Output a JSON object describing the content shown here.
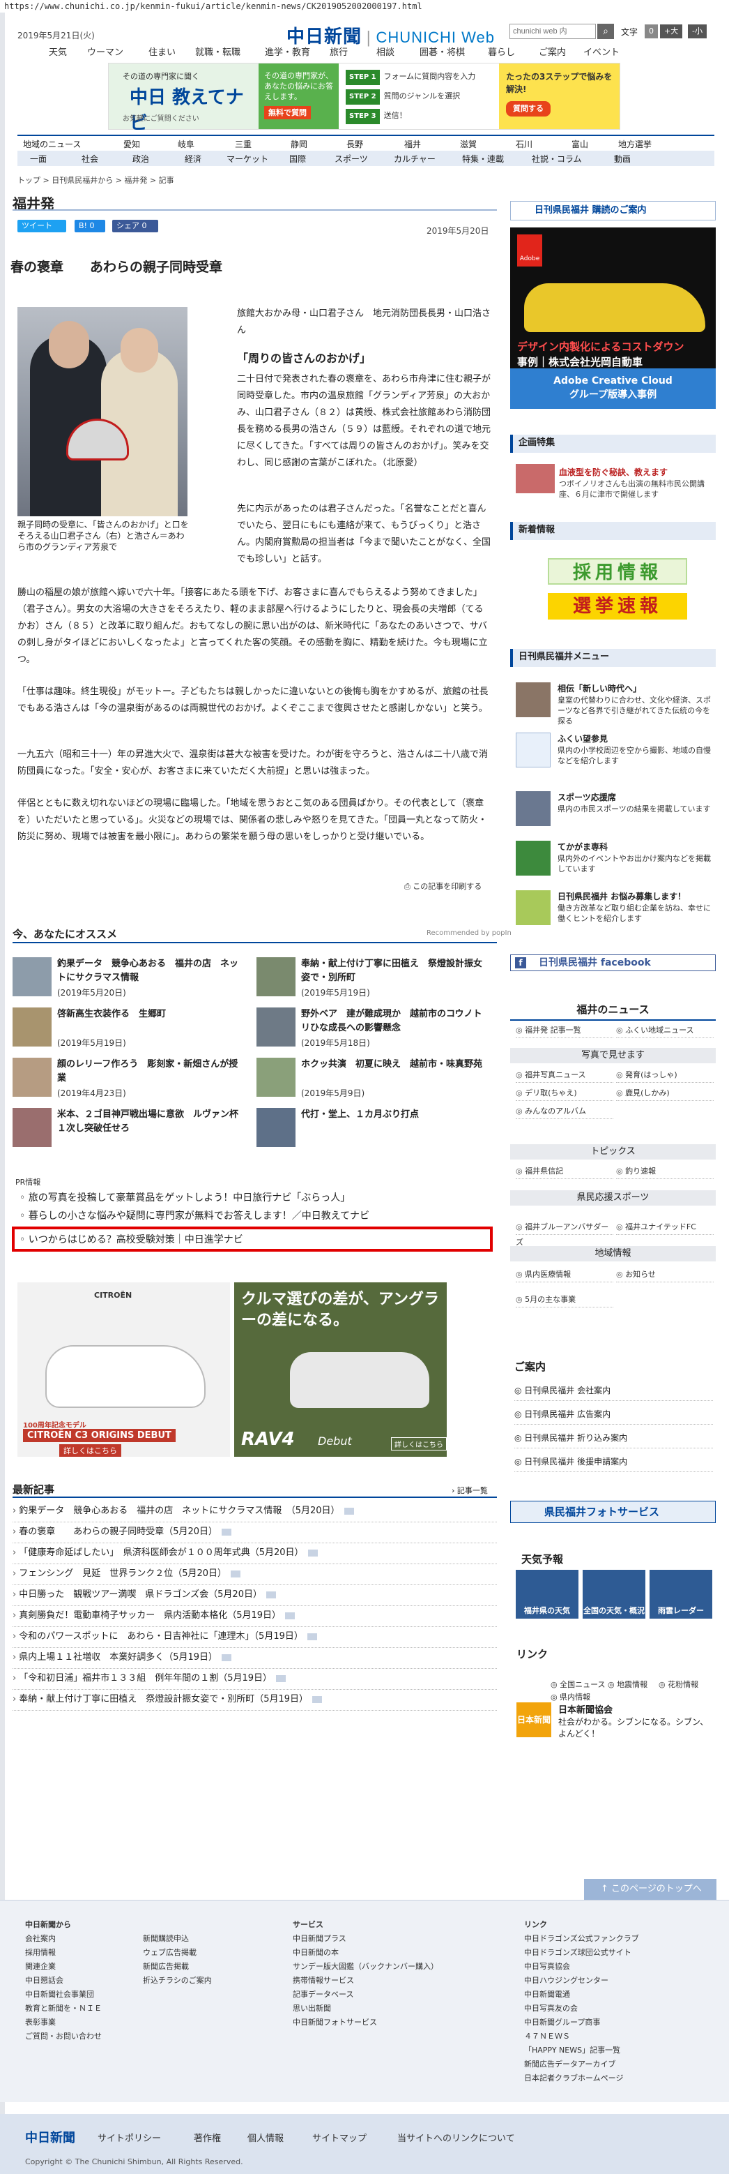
{
  "url": "https://www.chunichi.co.jp/kenmin-fukui/article/kenmin-news/CK2019052002000197.html",
  "header": {
    "date": "2019年5月21日(火)",
    "logo_jp": "中日新聞",
    "logo_en": "CHUNICHI Web",
    "search_placeholder": "chunichi web 内",
    "search_icon": "search-icon",
    "fontsize_label": "文字",
    "fontsize_reset": "0",
    "fontsize_up": "+大",
    "fontsize_down": "-小"
  },
  "topnav": [
    "天気",
    "ウーマン",
    "住まい",
    "就職・転職",
    "進学・教育",
    "旅行",
    "相談",
    "囲碁・将棋",
    "暮らし",
    "ご案内",
    "イベント"
  ],
  "banner": {
    "left_top": "その道の専門家に聞く",
    "left_title": "中日 教えてナビ",
    "left_note": "お気軽にご質問ください",
    "mid_text": "その道の専門家が、あなたの悩みにお答えします。",
    "mid_pill": "無料で質問",
    "steps": [
      {
        "step": "STEP 1",
        "text": "フォームに質問内容を入力"
      },
      {
        "step": "STEP 2",
        "text": "質問のジャンルを選択"
      },
      {
        "step": "STEP 3",
        "text": "送信！"
      }
    ],
    "right_title": "たったの3ステップで悩みを解決!",
    "right_btn": "質問する"
  },
  "regnav": [
    "地域のニュース",
    "愛知",
    "岐阜",
    "三重",
    "静岡",
    "長野",
    "福井",
    "滋賀",
    "石川",
    "富山",
    "地方選挙"
  ],
  "catnav": [
    "一面",
    "社会",
    "政治",
    "経済",
    "マーケット",
    "国際",
    "スポーツ",
    "カルチャー",
    "特集・連載",
    "社説・コラム",
    "動画"
  ],
  "breadcrumb": "トップ > 日刊県民福井から > 福井発 > 記事",
  "page_title": "福井発",
  "share": {
    "tweet": "ツイート",
    "b": "B! 0",
    "fb": "シェア 0"
  },
  "pub_date": "2019年5月20日",
  "article": {
    "headline": "春の褒章　　あわらの親子同時受章",
    "byline": "旅館大おかみ母・山口君子さん　地元消防団長長男・山口浩さん",
    "photo_caption": "親子同時の受章に、「皆さんのおかげ」と口をそろえる山口君子さん（右）と浩さん＝あわら市のグランディア芳泉で",
    "quote": "「周りの皆さんのおかげ」",
    "paragraphs": [
      "二十日付で発表された春の褒章を、あわら市舟津に住む親子が同時受章した。市内の温泉旅館「グランディア芳泉」の大おかみ、山口君子さん（８２）は黄綬、株式会社旅館あわら消防団長を務める長男の浩さん（５９）は藍綬。それぞれの道で地元に尽くしてきた。「すべては周りの皆さんのおかげ」。笑みを交わし、同じ感謝の言葉がこぼれた。（北原愛）",
      "先に内示があったのは君子さんだった。「名誉なことだと喜んでいたら、翌日にもにも連絡が来て、もうびっくり」と浩さん。内閣府賞勲局の担当者は「今まで聞いたことがなく、全国でも珍しい」と話す。",
      "勝山の稲屋の娘が旅館へ嫁いで六十年。「接客にあたる頭を下げ、お客さまに喜んでもらえるよう努めてきました」（君子さん）。男女の大浴場の大きさをそろえたり、軽のまま部屋へ行けるようにしたりと、現会長の夫増郎（てるかお）さん（８５）と改革に取り組んだ。おもてなしの腕に思い出がのは、新米時代に「あなたのあいさつで、サバの刺し身がタイほどにおいしくなったよ」と言ってくれた客の笑顔。その感動を胸に、精勤を続けた。今も現場に立つ。",
      "「仕事は趣味。終生現役」がモットー。子どもたちは親しかったに違いないとの後悔も胸をかすめるが、旅館の社長でもある浩さんは「今の温泉街があるのは両親世代のおかげ。よくぞここまで復興させたと感謝しかない」と笑う。",
      "一九五六（昭和三十一）年の昇進大火で、温泉街は甚大な被害を受けた。わが街を守ろうと、浩さんは二十八歳で消防団員になった。「安全・安心が、お客さまに来ていただく大前提」と思いは強まった。",
      "伴侶とともに数え切れないほどの現場に臨場した。「地域を思うおとこ気のある団員ばかり。その代表として（褒章を）いただいたと思っている」。火災などの現場では、関係者の悲しみや怒りを見てきた。「団員一丸となって防火・防災に努め、現場では被害を最小限に」。あわらの繁栄を願う母の思いをしっかりと受け継いでいる。"
    ],
    "print_link": "この記事を印刷する"
  },
  "recommend": {
    "title": "今、あなたにオススメ",
    "powered": "Recommended by popIn",
    "items": [
      {
        "title": "釣果データ　競争心あおる　福井の店　ネットにサクラマス情報",
        "date": "(2019年5月20日)"
      },
      {
        "title": "奉納・献上付け丁寧に田植え　祭燈設計振女姿で・別所町",
        "date": "(2019年5月19日)"
      },
      {
        "title": "啓新高生衣装作る　生郷町",
        "date": "(2019年5月19日)"
      },
      {
        "title": "野外ベア　建が難成現か　越前市のコウノトリひな成長への影響懸念",
        "date": "(2019年5月18日)"
      },
      {
        "title": "顔のレリーフ作ろう　彫刻家・新畑さんが授業",
        "date": "(2019年4月23日)"
      },
      {
        "title": "ホクッ共演　初夏に映え　越前市・味真野苑",
        "date": "(2019年5月9日)"
      },
      {
        "title": "米本、２ゴ目神戸戦出場に意欲　ルヴァン杯１次し突破任せろ",
        "date": ""
      },
      {
        "title": "代打・堂上、１カ月ぶり打点",
        "date": ""
      }
    ]
  },
  "pr": {
    "label": "PR情報",
    "links": [
      "旅の写真を投稿して豪華賞品をゲットしよう！中日旅行ナビ「ぶらっ人」",
      "暮らしの小さな悩みや疑問に専門家が無料でお答えします！／中日教えてナビ",
      "いつからはじめる？高校受験対策｜中日進学ナビ"
    ]
  },
  "ads": {
    "citroen_brand": "CITROËN",
    "citroen_l1": "100周年記念モデル",
    "citroen_l2": "CITROËN C3 ORIGINS DEBUT",
    "citroen_l3": "詳しくはこちら",
    "toyota_h": "クルマ選びの差が、アングラーの差になる。",
    "toyota_rav": "RAV4",
    "toyota_debut": "Debut",
    "toyota_det": "詳しくはこちら"
  },
  "latest": {
    "title": "最新記事",
    "all": "記事一覧",
    "items": [
      "釣果データ　競争心あおる　福井の店　ネットにサクラマス情報　（5月20日）",
      "春の褒章　　あわらの親子同時受章（5月20日）",
      "「健康寿命延ばしたい」　県済科医師会が１００周年式典（5月20日）",
      "フェンシング　見延　世界ランク２位（5月20日）",
      "中日勝った　観戦ツアー満喫　県ドラゴンズ会（5月20日）",
      "真剣勝負だ！電動車椅子サッカー　県内活動本格化（5月19日）",
      "令和のパワースポットに　あわら・日吉神社に「連理木」（5月19日）",
      "県内上場１１社増収　本業好調多く（5月19日）",
      "「令和初日浦」福井市１３３組　例年年間の１割（5月19日）",
      "奉納・献上付け丁寧に田植え　祭燈設計振女姿で・別所町（5月19日）"
    ]
  },
  "sidebar": {
    "koudoku": "日刊県民福井 購読のご案内",
    "adobe_brand": "Adobe",
    "adobe_l1": "デザイン内製化によるコストダウン",
    "adobe_l2": "事例｜株式会社光岡自動車",
    "adobe_l3": "Adobe Creative Cloud",
    "adobe_l4": "グループ版導入事例",
    "kikaku_title": "企画特集",
    "kikaku_item": "血液型を防ぐ秘訣、教えます",
    "kikaku_desc": "つボイノリオさんも出演の無料市民公開講座、６月に津市で開催します",
    "shinchaku_title": "新着情報",
    "saiyo": "採用情報",
    "senkyo": "選挙速報",
    "menu_title": "日刊県民福井メニュー",
    "menu": [
      {
        "t": "相伝「新しい時代へ」",
        "d": "皇室の代替わりに合わせ、文化や経済、スポーツなど各界で引き継がれてきた伝統の今を探る"
      },
      {
        "t": "ふくい望参見",
        "d": "県内の小学校周辺を空から撮影、地域の自慢などを紹介します"
      },
      {
        "t": "スポーツ応援席",
        "d": "県内の市民スポーツの結果を掲載しています"
      },
      {
        "t": "てかがま専科",
        "d": "県内外のイベントやお出かけ案内などを掲載しています"
      },
      {
        "t": "日刊県民福井 お悩み募集します！",
        "d": "働き方改革など取り組む企業を訪ね、幸せに働くヒントを紹介します"
      }
    ],
    "facebook": "日刊県民福井 facebook",
    "fukui_news": "福井のニュース",
    "fn_top": [
      "福井発 記事一覧",
      "ふくい地域ニュース"
    ],
    "fn_sections": [
      {
        "name": "写真で見せます",
        "items": [
          "福井写真ニュース",
          "発育(はっしゃ)",
          "デリ取(ちゃえ)",
          "鹿見(しかみ)",
          "みんなのアルバム"
        ]
      },
      {
        "name": "トピックス",
        "items": [
          "福井県信記",
          "釣り速報"
        ]
      },
      {
        "name": "県民応援スポーツ",
        "items": [
          "福井ユナイテッドFC",
          "福井ブルーアンバサダーズ"
        ]
      },
      {
        "name": "地域情報",
        "items": [
          "県内医療情報",
          "お知らせ",
          "5月の主な事業"
        ]
      }
    ],
    "goan_title": "ご案内",
    "goan": [
      "日刊県民福井 会社案内",
      "日刊県民福井 広告案内",
      "日刊県民福井 折り込み案内",
      "日刊県民福井 後援申請案内"
    ],
    "photosv": "県民福井フォトサービス",
    "wx_title": "天気予報",
    "wx": [
      "福井県の天気",
      "全国の天気・概況",
      "雨雲レーダー"
    ],
    "link_title": "リンク",
    "links": [
      "全国ニュース",
      "地震情報",
      "花粉情報",
      "県内情報"
    ],
    "jc_icon": "日本新聞協会",
    "jc_title": "日本新聞協会",
    "jc_desc": "社会がわかる。シブンになる。シブン、よんどく！"
  },
  "totop": "このページのトップへ",
  "footer": {
    "col1_head": "中日新聞から",
    "col1": [
      "会社案内",
      "採用情報",
      "関連企業",
      "中日懇話会",
      "中日新聞社会事業団",
      "教育と新聞を・ＮＩＥ",
      "表彰事業",
      "ご質問・お問い合わせ"
    ],
    "col2": [
      "新聞購読申込",
      "ウェブ広告掲載",
      "新聞広告掲載",
      "折込チラシのご案内"
    ],
    "col3_head": "サービス",
    "col3": [
      "中日新聞プラス",
      "中日新聞の本",
      "サンデー版大図鑑（バックナンバー購入）",
      "携帯情報サービス",
      "記事データベース",
      "思い出新聞",
      "中日新聞フォトサービス"
    ],
    "col4_head": "リンク",
    "col4": [
      "中日ドラゴンズ公式ファンクラブ",
      "中日ドラゴンズ球団公式サイト",
      "中日写真協会",
      "中日ハウジングセンター",
      "中日新聞電通",
      "中日写真友の会",
      "中日新聞グループ商事",
      "４７ＮＥＷＳ",
      "「HAPPY NEWS」記事一覧",
      "新聞広告データアーカイブ",
      "日本記者クラブホームページ"
    ],
    "bottom_logo": "中日新聞",
    "bottom_links": [
      "サイトポリシー",
      "著作権",
      "個人情報",
      "サイトマップ",
      "当サイトへのリンクについて"
    ],
    "copyright": "Copyright © The Chunichi Shimbun, All Rights Reserved."
  }
}
